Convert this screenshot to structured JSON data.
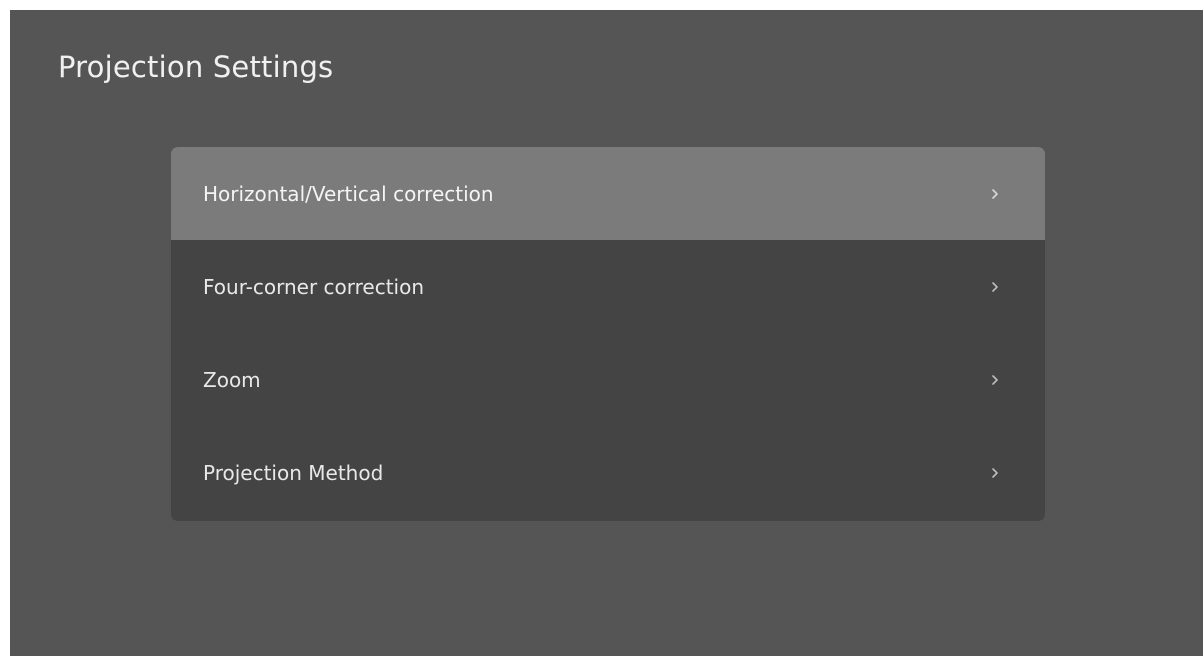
{
  "page": {
    "title": "Projection Settings"
  },
  "menu": {
    "items": [
      {
        "label": "Horizontal/Vertical correction",
        "selected": true,
        "icon": "chevron-right-icon"
      },
      {
        "label": "Four-corner correction",
        "selected": false,
        "icon": "chevron-right-icon"
      },
      {
        "label": "Zoom",
        "selected": false,
        "icon": "chevron-right-icon"
      },
      {
        "label": "Projection Method",
        "selected": false,
        "icon": "chevron-right-icon"
      }
    ]
  },
  "colors": {
    "background": "#555555",
    "menu_background": "#444444",
    "selected_background": "#7b7b7b",
    "text": "#ececec"
  }
}
